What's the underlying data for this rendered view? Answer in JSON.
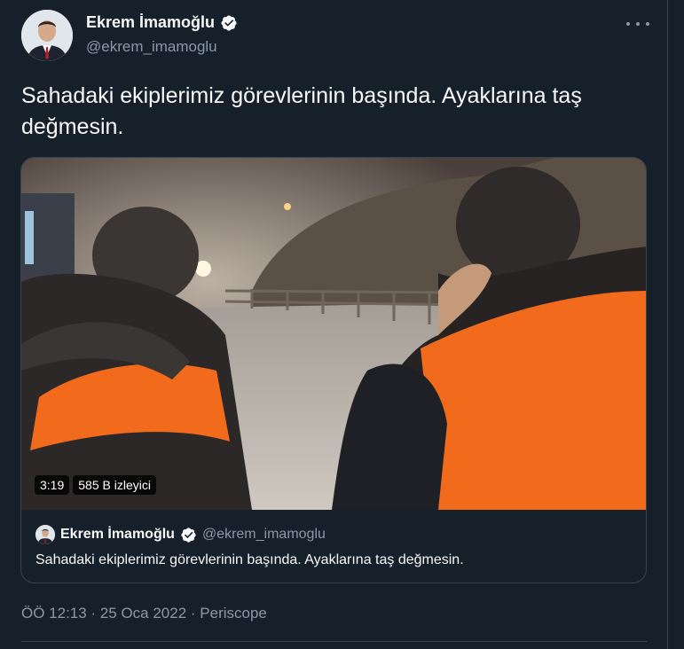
{
  "author": {
    "name": "Ekrem İmamoğlu",
    "handle": "@ekrem_imamoglu"
  },
  "tweet": {
    "text": "Sahadaki ekiplerimiz görevlerinin başında. Ayaklarına taş değmesin."
  },
  "video": {
    "duration": "3:19",
    "views": "585 B izleyici"
  },
  "quoted": {
    "name": "Ekrem İmamoğlu",
    "handle": "@ekrem_imamoglu",
    "text": "Sahadaki ekiplerimiz görevlerinin başında. Ayaklarına taş değmesin."
  },
  "meta": {
    "line": "ÖÖ 12:13 · 25 Oca 2022 · Periscope"
  },
  "colors": {
    "background": "#15202b",
    "verified": "#f7f9f9",
    "secondary_text": "#8b98a5",
    "border": "#38444d",
    "vest_orange": "#f26a1b"
  },
  "icons": [
    "verified-badge-icon",
    "more-options-icon"
  ]
}
